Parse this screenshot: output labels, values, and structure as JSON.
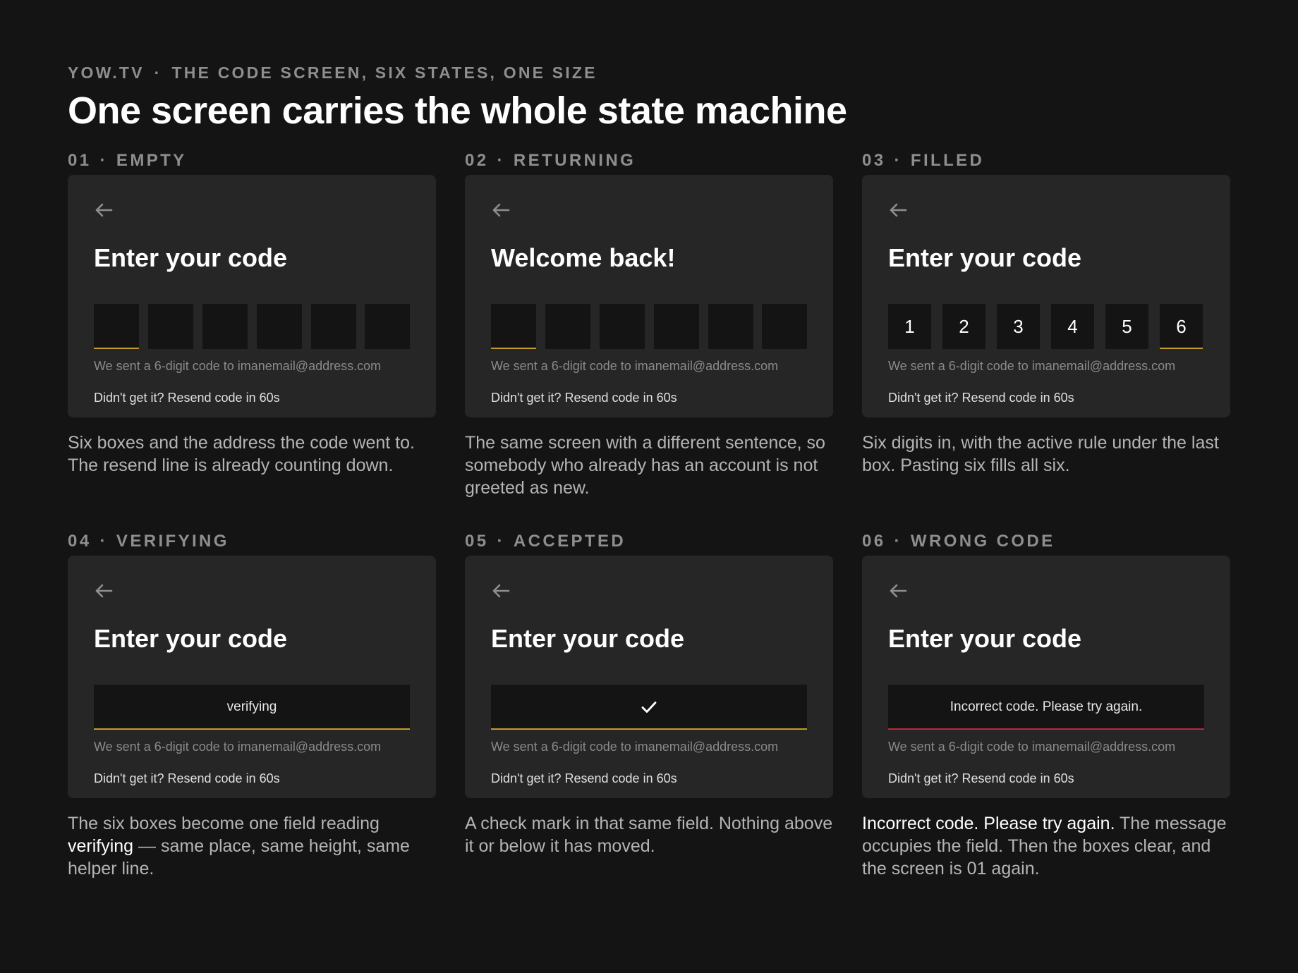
{
  "header": {
    "brand": "YOW.TV",
    "separator": "·",
    "subtitle": "THE CODE SCREEN, SIX STATES, ONE SIZE",
    "headline": "One screen carries the whole state machine"
  },
  "colors": {
    "background": "#141414",
    "card": "#262626",
    "field": "#141414",
    "accent_gold": "#c49a28",
    "error_red": "#b5283a"
  },
  "states": [
    {
      "number": "01",
      "name": "EMPTY",
      "title": "Enter your code",
      "digits": [
        "",
        "",
        "",
        "",
        "",
        ""
      ],
      "helper": "We sent a 6-digit code to imanemail@address.com",
      "resend": "Didn't get it? Resend code in 60s",
      "caption": "Six boxes and the address the code went to. The resend line is already counting down."
    },
    {
      "number": "02",
      "name": "RETURNING",
      "title": "Welcome back!",
      "digits": [
        "",
        "",
        "",
        "",
        "",
        ""
      ],
      "helper": "We sent a 6-digit code to imanemail@address.com",
      "resend": "Didn't get it? Resend code in 60s",
      "caption": "The same screen with a different sentence, so somebody who already has an account is not greeted as new."
    },
    {
      "number": "03",
      "name": "FILLED",
      "title": "Enter your code",
      "digits": [
        "1",
        "2",
        "3",
        "4",
        "5",
        "6"
      ],
      "helper": "We sent a 6-digit code to imanemail@address.com",
      "resend": "Didn't get it? Resend code in 60s",
      "caption": "Six digits in, with the active rule under the last box. Pasting six fills all six."
    },
    {
      "number": "04",
      "name": "VERIFYING",
      "title": "Enter your code",
      "field_text": "verifying",
      "helper": "We sent a 6-digit code to imanemail@address.com",
      "resend": "Didn't get it? Resend code in 60s",
      "caption_before": "The six boxes become one field reading",
      "caption_em": "verifying",
      "caption_after": "— same place, same height, same helper line."
    },
    {
      "number": "05",
      "name": "ACCEPTED",
      "title": "Enter your code",
      "field_icon": "check-icon",
      "helper": "We sent a 6-digit code to imanemail@address.com",
      "resend": "Didn't get it? Resend code in 60s",
      "caption": "A check mark in that same field. Nothing above it or below it has moved."
    },
    {
      "number": "06",
      "name": "WRONG CODE",
      "title": "Enter your code",
      "field_text": "Incorrect code. Please try again.",
      "helper": "We sent a 6-digit code to imanemail@address.com",
      "resend": "Didn't get it? Resend code in 60s",
      "caption_em": "Incorrect code. Please try again.",
      "caption_after": "The message occupies the field. Then the boxes clear, and the screen is 01 again."
    }
  ]
}
